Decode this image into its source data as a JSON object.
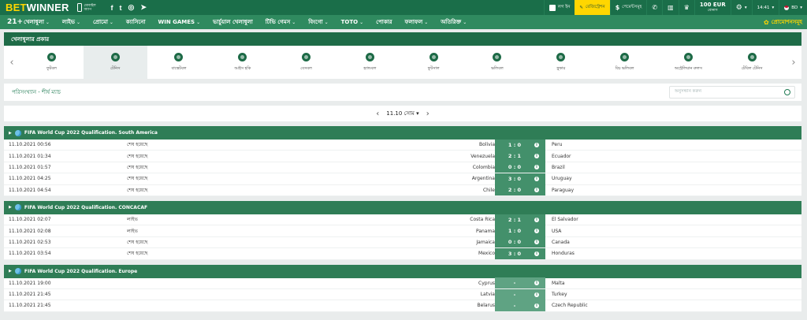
{
  "topbar": {
    "brand_a": "BET",
    "brand_b": "WINNER",
    "mobile_label": "মোবাইল অ্যাপ",
    "social": [
      "f",
      "t",
      "ig",
      "tg"
    ],
    "login": "লগ ইন",
    "register": "রেজিস্ট্রেশন",
    "payments": "পেমেন্টসমূহ",
    "balance_amount": "100 EUR",
    "balance_label": "বোনাস",
    "clock": "14:41",
    "language": "BD"
  },
  "nav": {
    "logo": "21+",
    "items": [
      {
        "label": "খেলাধুলা",
        "chev": true
      },
      {
        "label": "লাইভ",
        "chev": true
      },
      {
        "label": "প্রোমো",
        "chev": true
      },
      {
        "label": "ক্যাসিনো",
        "chev": false
      },
      {
        "label": "WIN GAMES",
        "chev": true
      },
      {
        "label": "ভার্চুয়াল খেলাধুলা",
        "chev": false
      },
      {
        "label": "টিভি গেমস",
        "chev": true
      },
      {
        "label": "বিংগো",
        "chev": true
      },
      {
        "label": "TOTO",
        "chev": true
      },
      {
        "label": "পোকার",
        "chev": false
      },
      {
        "label": "ফলাফল",
        "chev": true
      },
      {
        "label": "অতিরিক্ত",
        "chev": true
      }
    ],
    "promo": "প্রোমোশনসমূহ"
  },
  "sports": {
    "header": "খেলাধুলার প্রকার",
    "items": [
      {
        "label": "ফুটবল",
        "icon": "football-icon"
      },
      {
        "label": "টেনিস",
        "icon": "tennis-icon",
        "active": true
      },
      {
        "label": "বাস্কেটবল",
        "icon": "basketball-icon"
      },
      {
        "label": "আইস হকি",
        "icon": "ice-hockey-icon"
      },
      {
        "label": "বেসবল",
        "icon": "baseball-icon"
      },
      {
        "label": "হ্যান্ডবল",
        "icon": "handball-icon"
      },
      {
        "label": "ফুটসাল",
        "icon": "futsal-icon"
      },
      {
        "label": "ভলিবল",
        "icon": "volleyball-icon"
      },
      {
        "label": "স্নুকার",
        "icon": "snooker-icon"
      },
      {
        "label": "বিচ ভলিবল",
        "icon": "beach-volleyball-icon"
      },
      {
        "label": "অস্ট্রেলিয়ান রুলস",
        "icon": "australian-rules-icon"
      },
      {
        "label": "টেবিল টেনিস",
        "icon": "table-tennis-icon"
      }
    ]
  },
  "search": {
    "breadcrumb": "পরিসংখ্যান - শীর্ষ ম্যাচ",
    "placeholder": "অনুসন্ধান করুন"
  },
  "date": {
    "value": "11.10 সোম"
  },
  "leagues": [
    {
      "title": "FIFA World Cup 2022 Qualification. South America",
      "matches": [
        {
          "time": "11.10.2021 00:56",
          "status": "শেষ হয়েছে",
          "home": "Bolivia",
          "score": "1 : 0",
          "away": "Peru"
        },
        {
          "time": "11.10.2021 01:34",
          "status": "শেষ হয়েছে",
          "home": "Venezuela",
          "score": "2 : 1",
          "away": "Ecuador"
        },
        {
          "time": "11.10.2021 01:57",
          "status": "শেষ হয়েছে",
          "home": "Colombia",
          "score": "0 : 0",
          "away": "Brazil"
        },
        {
          "time": "11.10.2021 04:25",
          "status": "শেষ হয়েছে",
          "home": "Argentina",
          "score": "3 : 0",
          "away": "Uruguay"
        },
        {
          "time": "11.10.2021 04:54",
          "status": "শেষ হয়েছে",
          "home": "Chile",
          "score": "2 : 0",
          "away": "Paraguay"
        }
      ]
    },
    {
      "title": "FIFA World Cup 2022 Qualification. CONCACAF",
      "matches": [
        {
          "time": "11.10.2021 02:07",
          "status": "লাইভ",
          "home": "Costa Rica",
          "score": "2 : 1",
          "away": "El Salvador"
        },
        {
          "time": "11.10.2021 02:08",
          "status": "লাইভ",
          "home": "Panama",
          "score": "1 : 0",
          "away": "USA"
        },
        {
          "time": "11.10.2021 02:53",
          "status": "শেষ হয়েছে",
          "home": "Jamaica",
          "score": "0 : 0",
          "away": "Canada"
        },
        {
          "time": "11.10.2021 03:54",
          "status": "শেষ হয়েছে",
          "home": "Mexico",
          "score": "3 : 0",
          "away": "Honduras"
        }
      ]
    },
    {
      "title": "FIFA World Cup 2022 Qualification. Europe",
      "matches": [
        {
          "time": "11.10.2021 19:00",
          "status": "",
          "home": "Cyprus",
          "score": "-",
          "away": "Malta"
        },
        {
          "time": "11.10.2021 21:45",
          "status": "",
          "home": "Latvia",
          "score": "-",
          "away": "Turkey"
        },
        {
          "time": "11.10.2021 21:45",
          "status": "",
          "home": "Belarus",
          "score": "-",
          "away": "Czech Republic"
        }
      ]
    }
  ]
}
